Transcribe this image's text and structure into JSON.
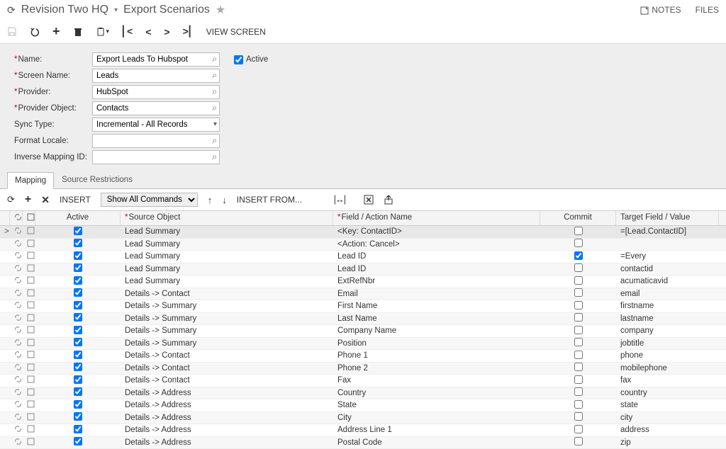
{
  "header": {
    "company": "Revision Two HQ",
    "screen_title": "Export Scenarios",
    "notes_label": "NOTES",
    "files_label": "FILES"
  },
  "toolbar": {
    "view_screen": "VIEW SCREEN"
  },
  "form": {
    "labels": {
      "name": "Name:",
      "screen_name": "Screen Name:",
      "provider": "Provider:",
      "provider_object": "Provider Object:",
      "sync_type": "Sync Type:",
      "format_locale": "Format Locale:",
      "inverse_mapping": "Inverse Mapping ID:",
      "active": "Active"
    },
    "values": {
      "name": "Export Leads To Hubspot",
      "screen_name": "Leads",
      "provider": "HubSpot",
      "provider_object": "Contacts",
      "sync_type": "Incremental - All Records",
      "format_locale": "",
      "inverse_mapping": "",
      "active_checked": true
    }
  },
  "tabs": {
    "mapping": "Mapping",
    "source_restrictions": "Source Restrictions"
  },
  "grid_toolbar": {
    "insert_label": "INSERT",
    "show_commands": "Show All Commands",
    "insert_from": "INSERT FROM..."
  },
  "grid": {
    "headers": {
      "active": "Active",
      "source_object": "Source Object",
      "field_action": "Field / Action Name",
      "commit": "Commit",
      "target": "Target Field / Value"
    },
    "rows": [
      {
        "selected": true,
        "active": true,
        "source": "Lead Summary",
        "field": "<Key: ContactID>",
        "commit": false,
        "target": "=[Lead.ContactID]"
      },
      {
        "active": true,
        "source": "Lead Summary",
        "field": "<Action: Cancel>",
        "commit": false,
        "target": ""
      },
      {
        "active": true,
        "source": "Lead Summary",
        "field": "Lead ID",
        "commit": true,
        "target": "=Every"
      },
      {
        "active": true,
        "source": "Lead Summary",
        "field": "Lead ID",
        "commit": false,
        "target": "contactid"
      },
      {
        "active": true,
        "source": "Lead Summary",
        "field": "ExtRefNbr",
        "commit": false,
        "target": "acumaticavid"
      },
      {
        "active": true,
        "source": "Details -> Contact",
        "field": "Email",
        "commit": false,
        "target": "email"
      },
      {
        "active": true,
        "source": "Details -> Summary",
        "field": "First Name",
        "commit": false,
        "target": "firstname"
      },
      {
        "active": true,
        "source": "Details -> Summary",
        "field": "Last Name",
        "commit": false,
        "target": "lastname"
      },
      {
        "active": true,
        "source": "Details -> Summary",
        "field": "Company Name",
        "commit": false,
        "target": "company"
      },
      {
        "active": true,
        "source": "Details -> Summary",
        "field": "Position",
        "commit": false,
        "target": "jobtitle"
      },
      {
        "active": true,
        "source": "Details -> Contact",
        "field": "Phone 1",
        "commit": false,
        "target": "phone"
      },
      {
        "active": true,
        "source": "Details -> Contact",
        "field": "Phone 2",
        "commit": false,
        "target": "mobilephone"
      },
      {
        "active": true,
        "source": "Details -> Contact",
        "field": "Fax",
        "commit": false,
        "target": "fax"
      },
      {
        "active": true,
        "source": "Details -> Address",
        "field": "Country",
        "commit": false,
        "target": "country"
      },
      {
        "active": true,
        "source": "Details -> Address",
        "field": "State",
        "commit": false,
        "target": "state"
      },
      {
        "active": true,
        "source": "Details -> Address",
        "field": "City",
        "commit": false,
        "target": "city"
      },
      {
        "active": true,
        "source": "Details -> Address",
        "field": "Address Line 1",
        "commit": false,
        "target": "address"
      },
      {
        "active": true,
        "source": "Details -> Address",
        "field": "Postal Code",
        "commit": false,
        "target": "zip"
      }
    ]
  }
}
